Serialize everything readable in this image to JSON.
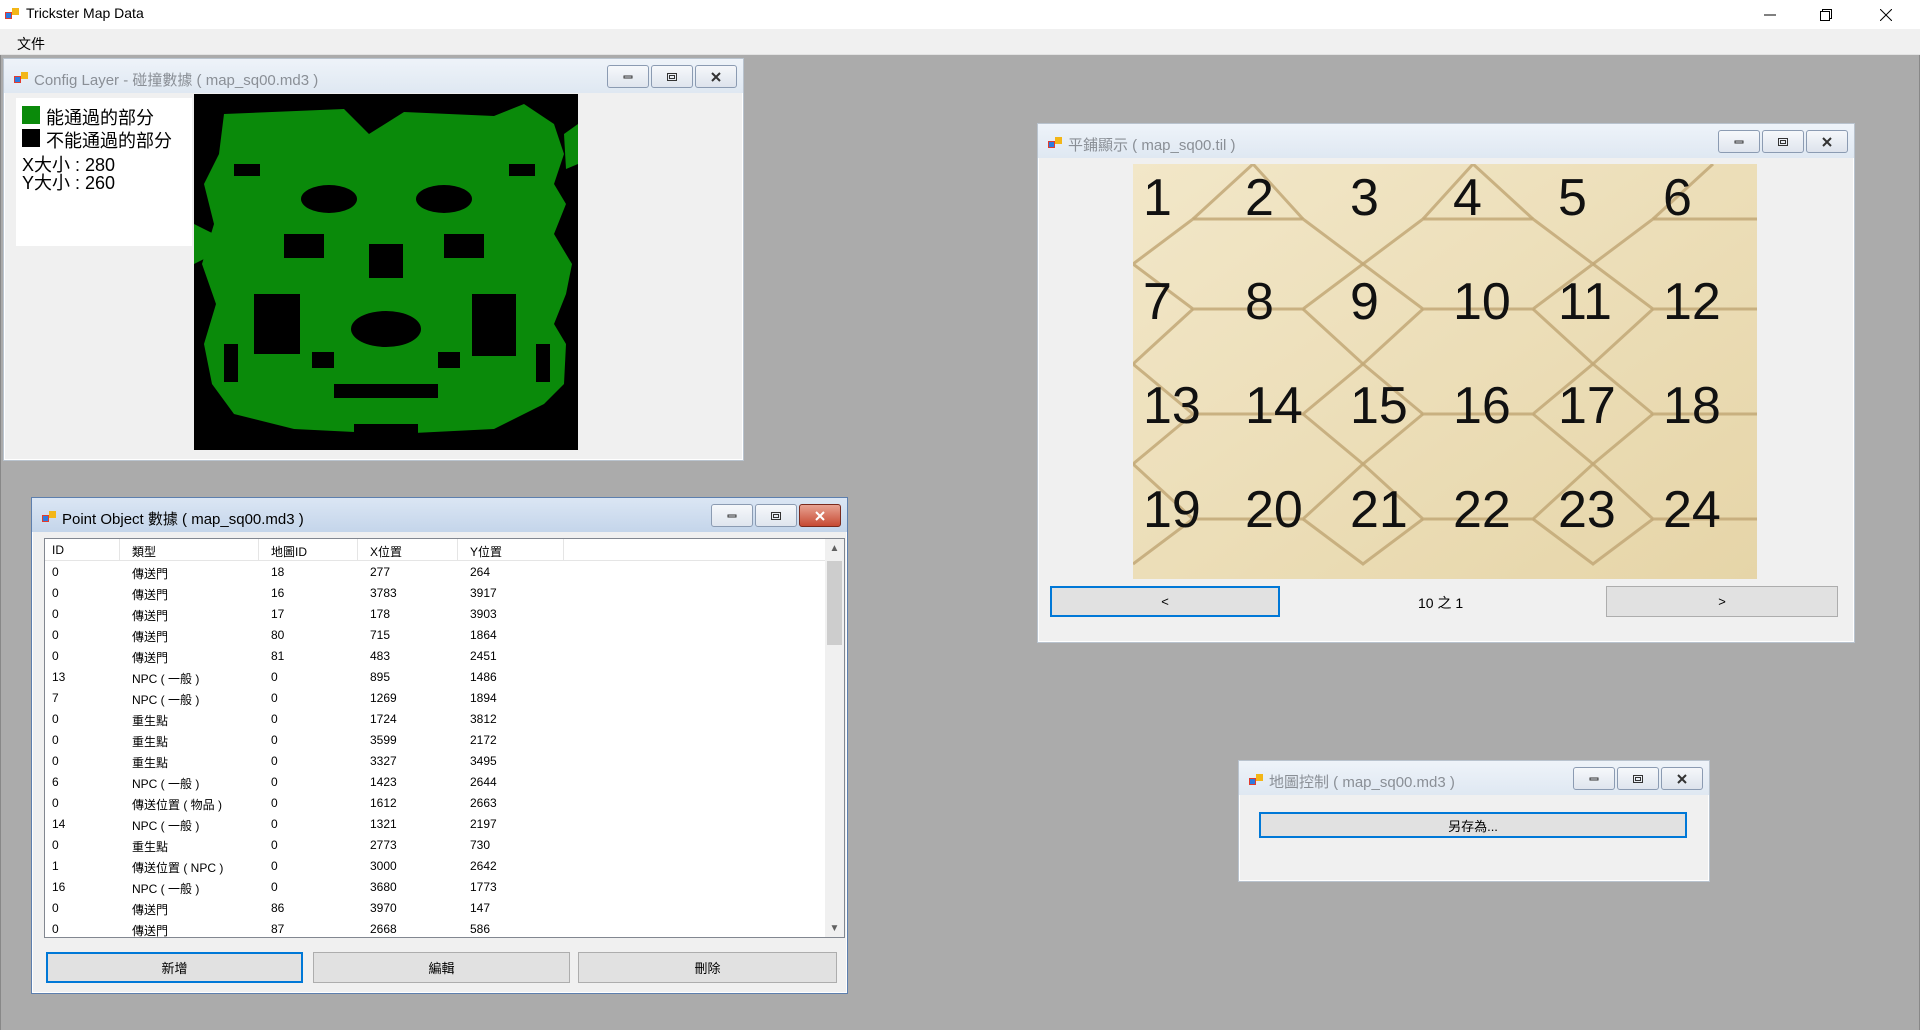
{
  "app": {
    "title": "Trickster Map Data",
    "menu": [
      "文件"
    ]
  },
  "config_window": {
    "title": "Config Layer - 碰撞數據 ( map_sq00.md3 )",
    "legend": {
      "passable_label": "能通過的部分",
      "blocked_label": "不能通過的部分",
      "x_size": "X大小 : 280",
      "y_size": "Y大小 : 260"
    },
    "colors": {
      "passable": "#0a8a0a",
      "blocked": "#000000"
    }
  },
  "point_window": {
    "title": "Point Object 數據 ( map_sq00.md3 )",
    "columns": [
      "ID",
      "類型",
      "地圖ID",
      "X位置",
      "Y位置"
    ],
    "rows": [
      [
        "0",
        "傳送門",
        "18",
        "277",
        "264"
      ],
      [
        "0",
        "傳送門",
        "16",
        "3783",
        "3917"
      ],
      [
        "0",
        "傳送門",
        "17",
        "178",
        "3903"
      ],
      [
        "0",
        "傳送門",
        "80",
        "715",
        "1864"
      ],
      [
        "0",
        "傳送門",
        "81",
        "483",
        "2451"
      ],
      [
        "13",
        "NPC ( 一般 )",
        "0",
        "895",
        "1486"
      ],
      [
        "7",
        "NPC ( 一般 )",
        "0",
        "1269",
        "1894"
      ],
      [
        "0",
        "重生點",
        "0",
        "1724",
        "3812"
      ],
      [
        "0",
        "重生點",
        "0",
        "3599",
        "2172"
      ],
      [
        "0",
        "重生點",
        "0",
        "3327",
        "3495"
      ],
      [
        "6",
        "NPC ( 一般 )",
        "0",
        "1423",
        "2644"
      ],
      [
        "0",
        "傳送位置 ( 物品 )",
        "0",
        "1612",
        "2663"
      ],
      [
        "14",
        "NPC ( 一般 )",
        "0",
        "1321",
        "2197"
      ],
      [
        "0",
        "重生點",
        "0",
        "2773",
        "730"
      ],
      [
        "1",
        "傳送位置 ( NPC )",
        "0",
        "3000",
        "2642"
      ],
      [
        "16",
        "NPC ( 一般 )",
        "0",
        "3680",
        "1773"
      ],
      [
        "0",
        "傳送門",
        "86",
        "3970",
        "147"
      ],
      [
        "0",
        "傳送門",
        "87",
        "2668",
        "586"
      ]
    ],
    "buttons": {
      "add": "新增",
      "edit": "編輯",
      "delete": "刪除"
    }
  },
  "tile_window": {
    "title": "平鋪顯示 ( map_sq00.til )",
    "tile_numbers": [
      "1",
      "2",
      "3",
      "4",
      "5",
      "6",
      "7",
      "8",
      "9",
      "10",
      "11",
      "12",
      "13",
      "14",
      "15",
      "16",
      "17",
      "18",
      "19",
      "20",
      "21",
      "22",
      "23",
      "24"
    ],
    "prev_label": "<",
    "next_label": ">",
    "pager": "10 之 1"
  },
  "control_window": {
    "title": "地圖控制 ( map_sq00.md3 )",
    "save_as_label": "另存為..."
  }
}
